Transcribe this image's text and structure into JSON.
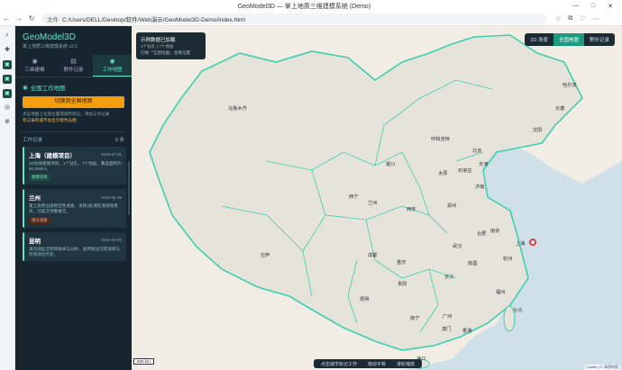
{
  "browser": {
    "title": "GeoModel3D — 掌上地质三维建模系统 (Demo)",
    "controls": [
      "—",
      "□",
      "✕"
    ],
    "url_tag": "文件",
    "url": "C:/Users/DELL/Desktop/软件/Web演示/GeoModel3D-Demo/index.html",
    "nav": [
      "←",
      "→",
      "↻"
    ],
    "right_tools": [
      "☆",
      "⧉",
      "♡",
      "⋯"
    ]
  },
  "edge_sidebar": [
    "⌕",
    "✚",
    "▣",
    "▣",
    "▣",
    "◎",
    "⊕"
  ],
  "app": {
    "brand": "GeoModel3D",
    "subtitle": "掌上地质三维建模系统 v2.0",
    "tabs": [
      {
        "icon": "◉",
        "label": "三维建模"
      },
      {
        "icon": "▤",
        "label": "野外记录"
      },
      {
        "icon": "◉",
        "label": "工作地图"
      }
    ],
    "section_title": "全国工作地图",
    "switch_button": "切换到全国地图",
    "hint1": "点击地图上任意位置或城市标记，添加工作记录",
    "hint2": "有记录的城市会显示橙色光圈",
    "worklog": {
      "title": "工作记录",
      "count": "6 条"
    },
    "cards": [
      {
        "city": "上海（建模项目）",
        "date": "2026-07-01",
        "desc": "3D地质建模项目，1个钻孔，7个地层，覆盖面积约50,000m²。",
        "badge": "建模项目",
        "badge_type": "green"
      },
      {
        "city": "兰州",
        "date": "2026-06-28",
        "desc": "黄土高原边坡稳定性调查，发现3处潜在滑坡隐患点，已提交预警报告。",
        "badge": "地灾调查",
        "badge_type": "red"
      },
      {
        "city": "昆明",
        "date": "2026-06-25",
        "desc": "滇池湖盆沉积物采样与分析，查明湖泊沉积速率与环境演化历史。",
        "badge": "",
        "badge_type": ""
      }
    ]
  },
  "map": {
    "toast": {
      "title": "示例数据已加载",
      "line1": "1个钻孔 | 7个地层",
      "line2": "切换「全国地图」查看位置"
    },
    "tools": [
      "3D 场景",
      "全国地图",
      "野外记录"
    ],
    "cities": [
      "乌鲁木齐",
      "哈尔滨",
      "长春",
      "沈阳",
      "呼和浩特",
      "北京",
      "天津",
      "石家庄",
      "太原",
      "银川",
      "济南",
      "西宁",
      "兰州",
      "郑州",
      "西安",
      "合肥",
      "南京",
      "上海",
      "武汉",
      "杭州",
      "拉萨",
      "成都",
      "重庆",
      "长沙",
      "南昌",
      "福州",
      "贵阳",
      "昆明",
      "南宁",
      "广州",
      "台北",
      "香港",
      "澳门",
      "海口"
    ],
    "scale": "500 km",
    "bottom": [
      "点击城市标记工作",
      "拖动平移",
      "滚轮缩放"
    ],
    "attribution": "Leaflet | © 高德地图"
  }
}
